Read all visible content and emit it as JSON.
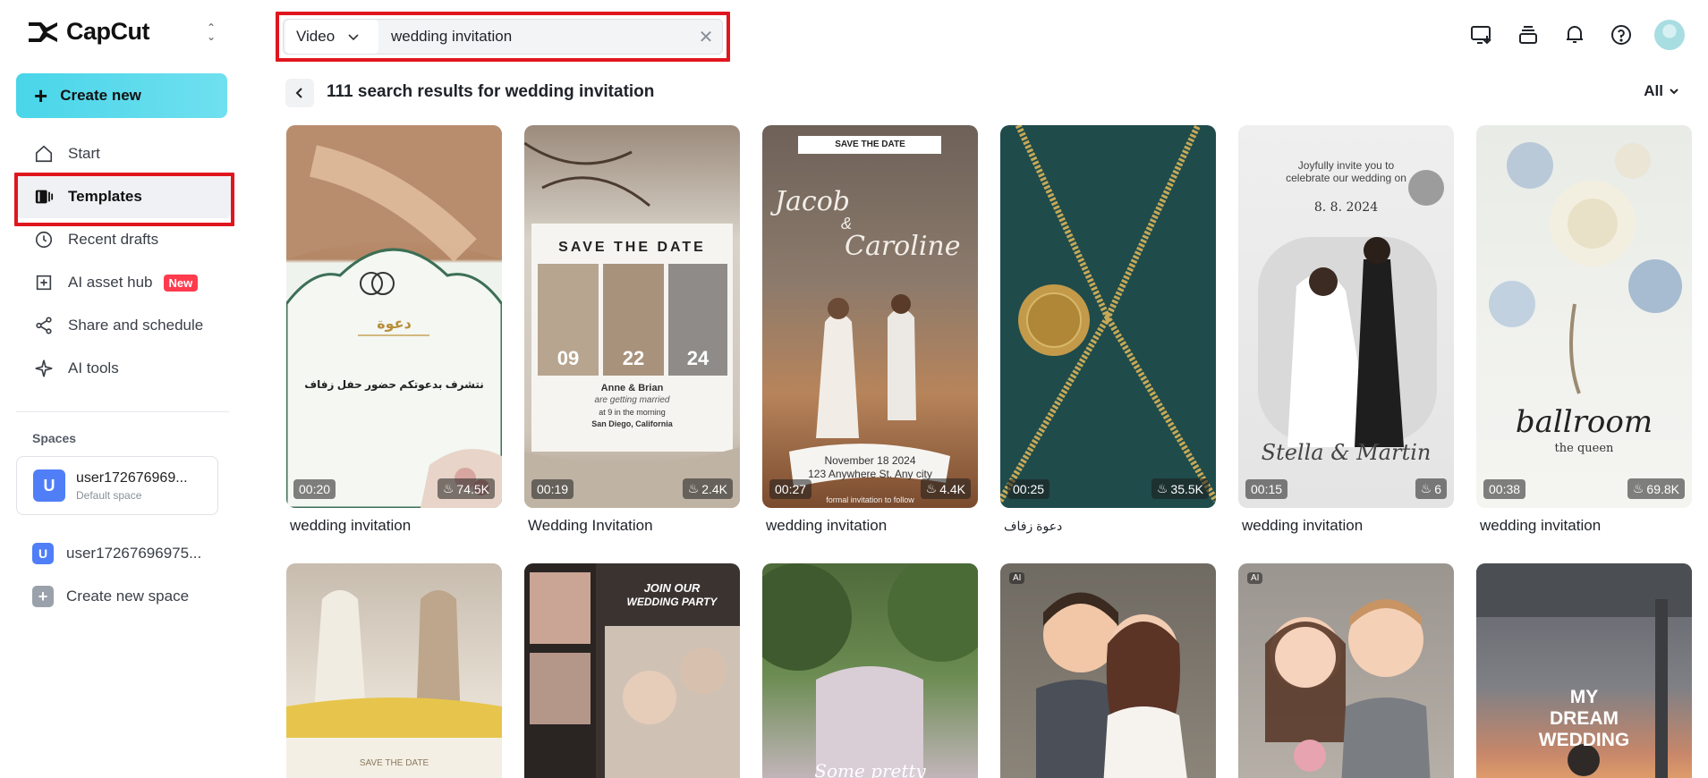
{
  "app": {
    "name": "CapCut"
  },
  "sidebar": {
    "create_label": "Create new",
    "items": [
      {
        "label": "Start",
        "icon": "home-icon"
      },
      {
        "label": "Templates",
        "icon": "templates-icon"
      },
      {
        "label": "Recent drafts",
        "icon": "clock-icon"
      },
      {
        "label": "AI asset hub",
        "icon": "asset-hub-icon",
        "badge": "New"
      },
      {
        "label": "Share and schedule",
        "icon": "share-icon"
      },
      {
        "label": "AI tools",
        "icon": "sparkle-icon"
      }
    ],
    "spaces_title": "Spaces",
    "current_space": {
      "avatar": "U",
      "name": "user172676969...",
      "subtitle": "Default space"
    },
    "other_space": {
      "avatar": "U",
      "name": "user17267696975..."
    },
    "create_space_label": "Create new space"
  },
  "search": {
    "type_label": "Video",
    "query": "wedding invitation"
  },
  "results": {
    "title": "111 search results for wedding invitation",
    "filter_label": "All"
  },
  "cards": [
    {
      "title": "wedding invitation",
      "duration": "00:20",
      "uses": "74.5K",
      "art_text": [
        "دعوة",
        "نتشرف بدعوتكم حضور حفل زفاف"
      ]
    },
    {
      "title": "Wedding Invitation",
      "duration": "00:19",
      "uses": "2.4K",
      "art_text": [
        "SAVE THE DATE",
        "09",
        "22",
        "24",
        "Anne & Brian",
        "are getting married",
        "at 9 in the morning",
        "San Diego, California"
      ]
    },
    {
      "title": "wedding invitation",
      "duration": "00:27",
      "uses": "4.4K",
      "art_text": [
        "SAVE THE DATE",
        "Jacob",
        "&",
        "Caroline",
        "November 18 2024",
        "123 Anywhere St. Any city",
        "formal invitation to follow"
      ]
    },
    {
      "title": "دعوة زفاف",
      "duration": "00:25",
      "uses": "35.5K",
      "art_text": []
    },
    {
      "title": "wedding invitation",
      "duration": "00:15",
      "uses": "6",
      "art_text": [
        "Joyfully invite you to",
        "celebrate our wedding on",
        "8. 8. 2024",
        "Stella & Martin"
      ]
    },
    {
      "title": "wedding invitation",
      "duration": "00:38",
      "uses": "69.8K",
      "art_text": [
        "ballroom",
        "the queen"
      ]
    }
  ],
  "cards_row2": [
    {
      "art_text": [
        "SAVE THE DATE"
      ]
    },
    {
      "art_text": [
        "JOIN OUR",
        "WEDDING PARTY"
      ]
    },
    {
      "art_text": [
        "Some pretty"
      ]
    },
    {
      "badge": "AI",
      "art_text": []
    },
    {
      "badge": "AI",
      "art_text": []
    },
    {
      "art_text": [
        "MY",
        "DREAM",
        "WEDDING"
      ]
    }
  ],
  "colors": {
    "accent": "#49d5e9",
    "highlight_red": "#e0161e",
    "badge_red": "#ff3b4e",
    "space_blue": "#4f7ef7"
  }
}
